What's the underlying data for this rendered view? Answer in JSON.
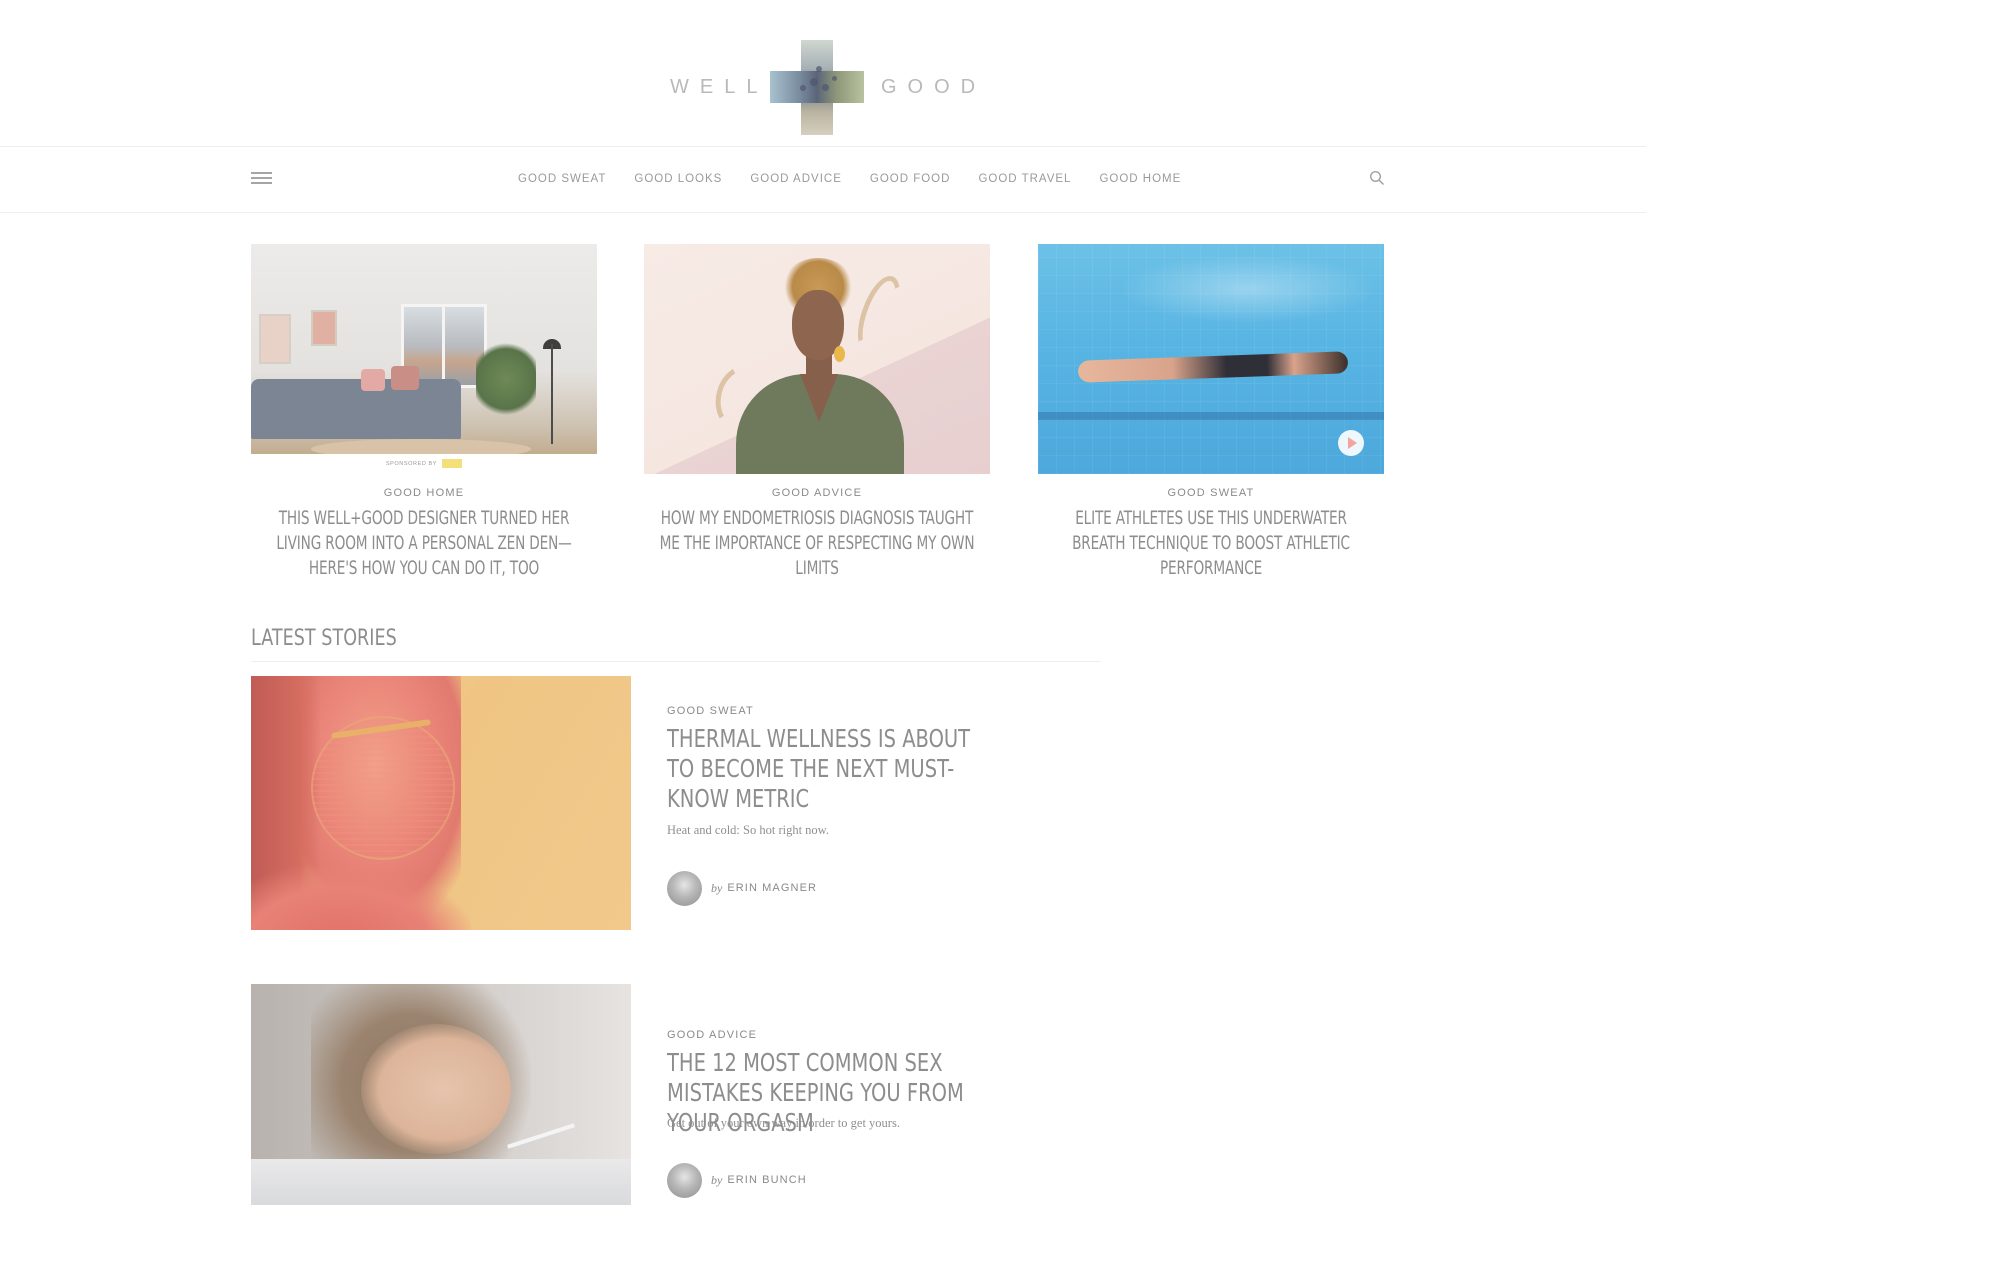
{
  "brand": {
    "left_word": "WELL",
    "right_word": "GOOD"
  },
  "nav": {
    "items": [
      {
        "label": "GOOD SWEAT"
      },
      {
        "label": "GOOD LOOKS"
      },
      {
        "label": "GOOD ADVICE"
      },
      {
        "label": "GOOD FOOD"
      },
      {
        "label": "GOOD TRAVEL"
      },
      {
        "label": "GOOD HOME"
      }
    ],
    "menu_icon": "hamburger-menu-icon",
    "search_icon": "search-icon"
  },
  "featured": [
    {
      "category": "GOOD HOME",
      "title": "THIS WELL+GOOD DESIGNER TURNED HER LIVING ROOM INTO A PERSONAL ZEN DEN—HERE'S HOW YOU CAN DO IT, TOO",
      "sponsor_label": "SPONSORED BY",
      "image": "living-room-photo"
    },
    {
      "category": "GOOD ADVICE",
      "title": "HOW MY ENDOMETRIOSIS DIAGNOSIS TAUGHT ME THE IMPORTANCE OF RESPECTING MY OWN LIMITS",
      "image": "woman-portrait-illustration"
    },
    {
      "category": "GOOD SWEAT",
      "title": "ELITE ATHLETES USE THIS UNDERWATER BREATH TECHNIQUE TO BOOST ATHLETIC PERFORMANCE",
      "image": "underwater-swimmer-photo",
      "play_icon": "play-icon"
    }
  ],
  "latest": {
    "heading": "LATEST STORIES",
    "stories": [
      {
        "category": "GOOD SWEAT",
        "title": "THERMAL WELLNESS IS ABOUT TO BECOME THE NEXT MUST-KNOW METRIC",
        "dek": "Heat and cold: So hot right now.",
        "by": "by",
        "author": "ERIN MAGNER",
        "image": "led-mask-face-photo"
      },
      {
        "category": "GOOD ADVICE",
        "title": "THE 12 MOST COMMON SEX MISTAKES KEEPING YOU FROM YOUR ORGASM",
        "dek": "Get out of your own way in order to get yours.",
        "by": "by",
        "author": "ERIN BUNCH",
        "image": "woman-smiling-photo"
      }
    ]
  },
  "colors": {
    "text": "#8a8a8a",
    "rule": "#eeeeee",
    "pool": "#57b4e3",
    "accent_warm": "#f1c98b"
  }
}
